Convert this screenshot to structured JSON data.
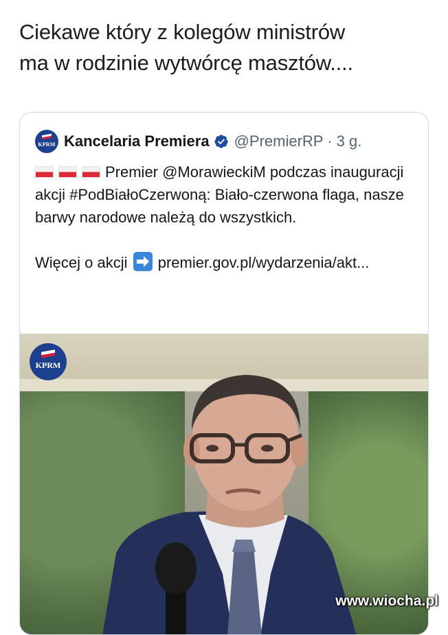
{
  "post": {
    "text_line1": "Ciekawe który z kolegów ministrów",
    "text_line2": "ma w rodzinie wytwórcę masztów...."
  },
  "quoted": {
    "avatar_text": "KPRM",
    "name": "Kancelaria Premiera",
    "handle_time": "@PremierRP · 3 g.",
    "body_p1": "Premier @MorawieckiM podczas inauguracji akcji #PodBiałoCzerwoną: Biało-czerwona flaga, nasze barwy narodowe należą do wszystkich.",
    "body_p2_prefix": "Więcej o akcji",
    "body_p2_link": "premier.gov.pl/wydarzenia/akt...",
    "media_logo_text": "KPRM"
  },
  "watermark": "www.wiocha.pl",
  "colors": {
    "verified": "#1d4ea0",
    "kprm_blue": "#1c3f8e",
    "flag_red": "#dc2a38"
  }
}
